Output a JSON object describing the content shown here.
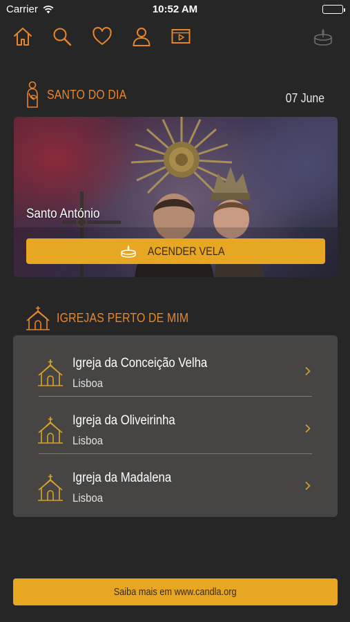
{
  "status_bar": {
    "carrier": "Carrier",
    "time": "10:52 AM"
  },
  "nav": {
    "icons": [
      "home-icon",
      "search-icon",
      "heart-icon",
      "profile-icon",
      "video-icon",
      "candle-icon"
    ],
    "accent": "#e8862c"
  },
  "saint_section": {
    "title": "SANTO DO DIA",
    "date": "07 June",
    "saint_name": "Santo António",
    "button_label": "ACENDER VELA"
  },
  "churches_section": {
    "title": "IGREJAS PERTO DE MIM",
    "items": [
      {
        "name": "Igreja da Conceição Velha",
        "city": "Lisboa"
      },
      {
        "name": "Igreja da Oliveirinha",
        "city": "Lisboa"
      },
      {
        "name": "Igreja da Madalena",
        "city": "Lisboa"
      }
    ]
  },
  "footer": {
    "label": "Saiba mais em www.candla.org"
  },
  "colors": {
    "accent_orange": "#e8862c",
    "button_yellow": "#e8a722",
    "background": "#262626",
    "card": "#464543"
  }
}
